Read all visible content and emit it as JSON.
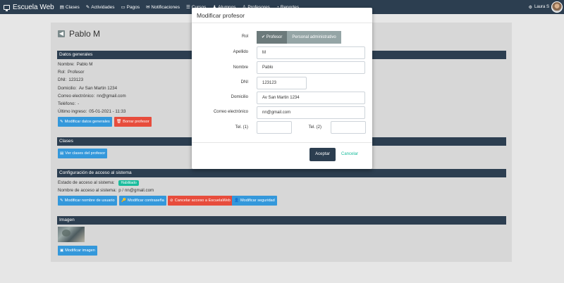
{
  "navbar": {
    "brand": "Escuela Web",
    "items": [
      {
        "label": "Clases",
        "icon": "book-icon"
      },
      {
        "label": "Actividades",
        "icon": "pencil-icon"
      },
      {
        "label": "Pagos",
        "icon": "money-icon"
      },
      {
        "label": "Notificaciones",
        "icon": "envelope-icon"
      },
      {
        "label": "Cursos",
        "icon": "list-icon"
      },
      {
        "label": "Alumnos",
        "icon": "users-icon"
      },
      {
        "label": "Profesores",
        "icon": "teacher-icon"
      },
      {
        "label": "Reportes",
        "icon": "chart-icon"
      }
    ],
    "user": "Laura S"
  },
  "page": {
    "title": "Pablo M",
    "sections": {
      "general": "Datos generales",
      "clases": "Clases",
      "acceso": "Configuración de acceso al sistema",
      "imagen": "Imagen"
    },
    "general": {
      "nombre_label": "Nombre:",
      "nombre": "Pablo M",
      "rol_label": "Rol:",
      "rol": "Profesor",
      "dni_label": "DNI:",
      "dni": "123123",
      "domicilio_label": "Domicilio:",
      "domicilio": "Av San Martin 1234",
      "correo_label": "Correo electrónico:",
      "correo": "nn@gmail.com",
      "telefono_label": "Teléfono:",
      "telefono": "-",
      "ultimo_label": "Último ingreso:",
      "ultimo": "05-01-2021 - 11:33"
    },
    "buttons": {
      "modificar_datos": "Modificar datos generales",
      "borrar": "Borrar profesor",
      "ver_clases": "Ver clases del profesor",
      "modificar_usuario": "Modificar nombre de usuario",
      "modificar_contrasena": "Modificar contraseña",
      "cancelar_acceso": "Cancelar acceso a EscuelaWeb",
      "modificar_seguridad": "Modificar seguridad",
      "modificar_imagen": "Modificar imagen"
    },
    "acceso": {
      "estado_label": "Estado de acceso al sistema:",
      "estado": "Habilitado",
      "usuario_label": "Nombre de acceso al sistema:",
      "usuario": "p / nn@gmail.com"
    }
  },
  "modal": {
    "title": "Modificar profesor",
    "rol_label": "Rol",
    "rol_options": [
      "Profesor",
      "Personal administrativo"
    ],
    "apellido_label": "Apellido",
    "apellido": "M",
    "nombre_label": "Nombre",
    "nombre": "Pablo",
    "dni_label": "DNI",
    "dni": "123123",
    "domicilio_label": "Domicilio",
    "domicilio": "Av San Martin 1234",
    "correo_label": "Correo electrónico",
    "correo": "nn@gmail.com",
    "tel1_label": "Tel. (1)",
    "tel1": "",
    "tel2_label": "Tel. (2)",
    "tel2": "",
    "accept": "Aceptar",
    "cancel": "Cancelar"
  },
  "icons": {
    "check": "✔",
    "back": "◀",
    "edit": "✎",
    "trash": "🗑",
    "book": "▤",
    "key": "🔑",
    "ban": "⊘",
    "user": "👤",
    "image": "▣",
    "gear": "⚙"
  },
  "colors": {
    "navbar": "#2c3e50",
    "primary": "#3498db",
    "danger": "#e74c3c",
    "success": "#18bc9c",
    "secondary": "#95a5a6"
  }
}
